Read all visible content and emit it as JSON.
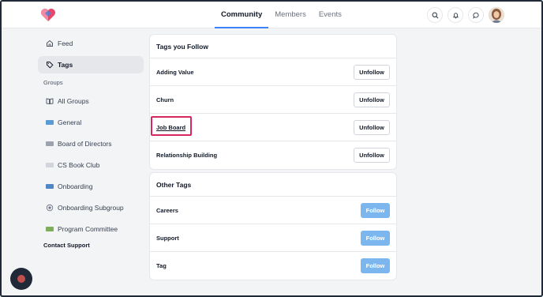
{
  "header": {
    "tabs": [
      {
        "label": "Community",
        "active": true
      },
      {
        "label": "Members",
        "active": false
      },
      {
        "label": "Events",
        "active": false
      }
    ],
    "icons": [
      "search-icon",
      "bell-icon",
      "chat-icon"
    ],
    "accent": "#3b82f6"
  },
  "sidebar": {
    "feed": "Feed",
    "tags": "Tags",
    "groups_heading": "Groups",
    "groups": [
      {
        "label": "All Groups",
        "icon": "book-icon"
      },
      {
        "label": "General",
        "icon": "flag-icon",
        "color": "#5b9bd5"
      },
      {
        "label": "Board of Directors",
        "icon": "flag-icon",
        "color": "#9ca3af"
      },
      {
        "label": "CS Book Club",
        "icon": "flag-icon",
        "color": "#d1d5db"
      },
      {
        "label": "Onboarding",
        "icon": "flag-icon",
        "color": "#4f86c6"
      },
      {
        "label": "Onboarding Subgroup",
        "icon": "badge-icon",
        "color": "#9ca3af"
      },
      {
        "label": "Program Committee",
        "icon": "flag-icon",
        "color": "#7fae5a"
      }
    ],
    "contact": "Contact Support"
  },
  "followed": {
    "title": "Tags you Follow",
    "button_label": "Unfollow",
    "tags": [
      "Adding Value",
      "Churn",
      "Job Board",
      "Relationship Building"
    ]
  },
  "other": {
    "title": "Other Tags",
    "button_label": "Follow",
    "tags": [
      "Careers",
      "Support",
      "Tag"
    ]
  },
  "colors": {
    "follow_button": "#7cb6ee",
    "highlight": "#d6285e"
  }
}
